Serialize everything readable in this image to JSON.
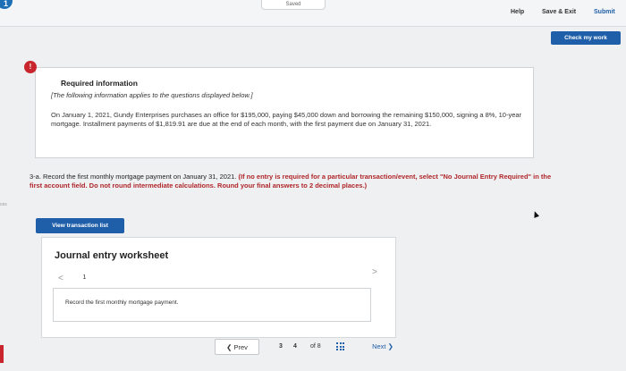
{
  "header": {
    "saved_label": "Saved",
    "help_label": "Help",
    "save_exit_label": "Save & Exit",
    "submit_label": "Submit",
    "check_label": "Check my work",
    "corner_badge": "1"
  },
  "info": {
    "alert_glyph": "!",
    "title": "Required information",
    "italic_note": "[The following information applies to the questions displayed below.]",
    "body": "On January 1, 2021, Gundy Enterprises purchases an office for $195,000, paying $45,000 down and borrowing the remaining $150,000, signing a 8%, 10-year mortgage. Installment payments of $1,819.91 are due at the end of each month, with the first payment due on January 31, 2021."
  },
  "question": {
    "lead": "3-a. Record the first monthly mortgage payment on January 31, 2021.",
    "instructions": "(If no entry is required for a particular transaction/event, select \"No Journal Entry Required\" in the first account field. Do not round intermediate calculations. Round your final answers to 2 decimal places.)"
  },
  "left_edge_text": "ces",
  "view_transaction_label": "View transaction list",
  "worksheet": {
    "title": "Journal entry worksheet",
    "prev_glyph": "<",
    "next_glyph": ">",
    "current_page": "1",
    "entry_text": "Record the first monthly mortgage payment."
  },
  "nav": {
    "prev_label": "Prev",
    "page_prev": "3",
    "page_current": "4",
    "of_label": "of 8",
    "next_label": "Next"
  },
  "colors": {
    "accent_blue": "#1f5ea8",
    "alert_red": "#c8262c",
    "instruction_red": "#b0262b"
  }
}
